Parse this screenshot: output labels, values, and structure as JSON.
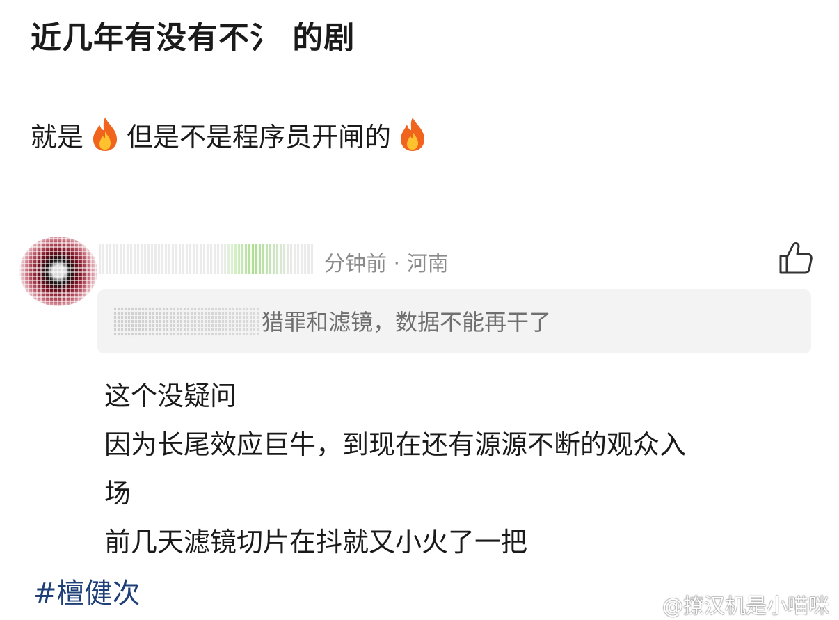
{
  "post": {
    "title": "近几年有没有不氵 的剧",
    "body_prefix": "就是",
    "body_middle": "但是不是程序员开闸的",
    "fire_icon": "fire-emoji"
  },
  "comment": {
    "time_location": "分钟前 · 河南",
    "quote_text": "猎罪和滤镜，数据不能再干了",
    "reply_lines": [
      "这个没疑问",
      "因为长尾效应巨牛，到现在还有源源不断的观众入",
      "场",
      "前几天滤镜切片在抖就又小火了一把"
    ]
  },
  "hashtag": "#檀健次",
  "watermark": "@撩汉机是小喵咪",
  "colors": {
    "hashtag": "#1e3f78",
    "meta_gray": "#8a8a8a",
    "quote_bg": "#f3f3f3"
  }
}
